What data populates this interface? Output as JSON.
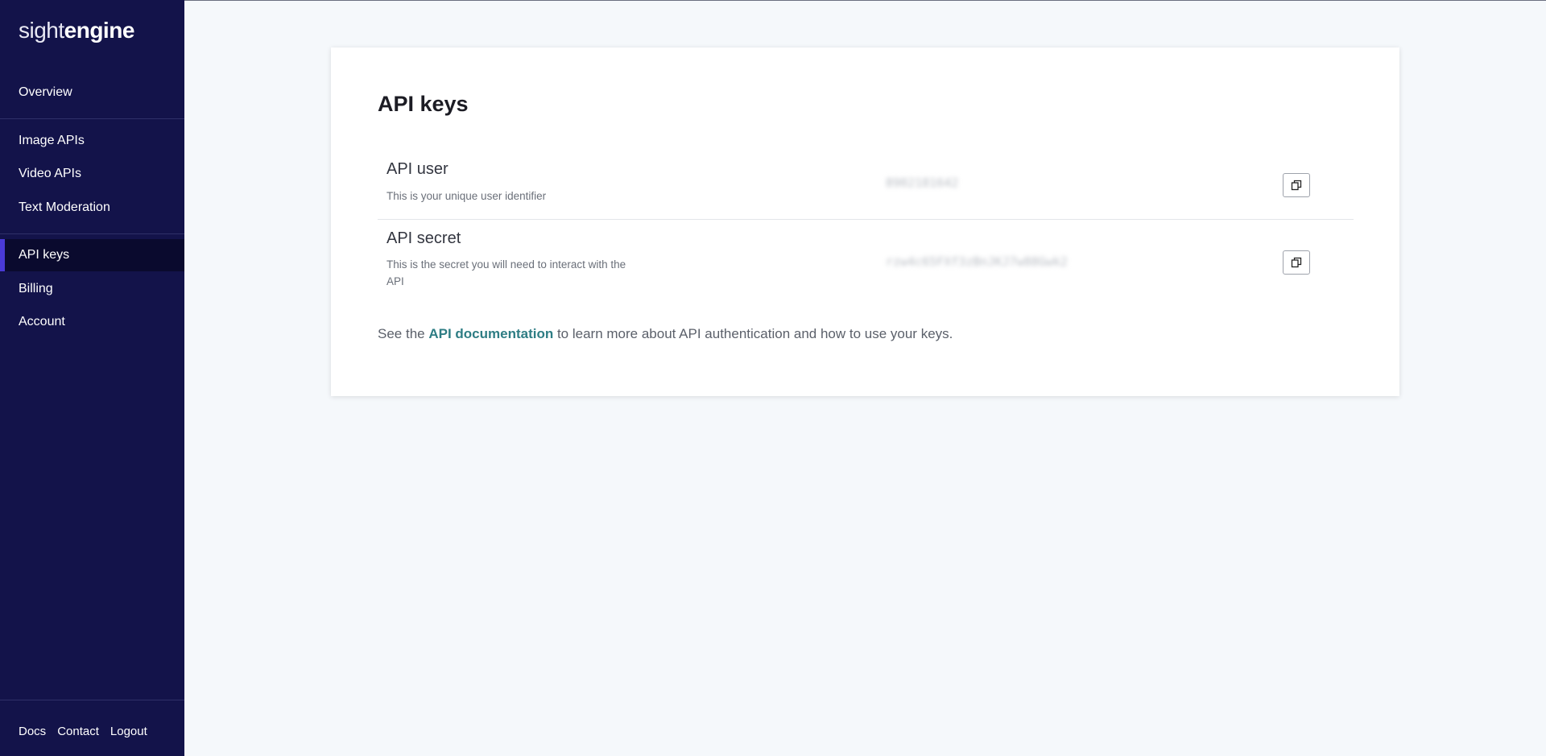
{
  "brand": {
    "light": "sight",
    "bold": "engine"
  },
  "sidebar": {
    "items": [
      {
        "label": "Overview"
      },
      {
        "label": "Image APIs"
      },
      {
        "label": "Video APIs"
      },
      {
        "label": "Text Moderation"
      },
      {
        "label": "API keys",
        "active": true
      },
      {
        "label": "Billing"
      },
      {
        "label": "Account"
      }
    ],
    "footer": [
      "Docs",
      "Contact",
      "Logout"
    ]
  },
  "main": {
    "title": "API keys",
    "keys": [
      {
        "label": "API user",
        "description": "This is your unique user identifier",
        "value": "8902181642"
      },
      {
        "label": "API secret",
        "description": "This is the secret you will need to interact with the API",
        "value": "rzw4c65FXf3zBnJKJ7w88Gwk2"
      }
    ],
    "doc_prefix": "See the ",
    "doc_link": "API documentation",
    "doc_suffix": " to learn more about API authentication and how to use your keys."
  },
  "colors": {
    "sidebar_bg": "#13134a",
    "active_bg": "#0a0a2e",
    "active_accent": "#4a3ad6",
    "link": "#2e7d84",
    "page_bg": "#f5f8fb"
  },
  "icons": {
    "copy": "copy-icon"
  }
}
